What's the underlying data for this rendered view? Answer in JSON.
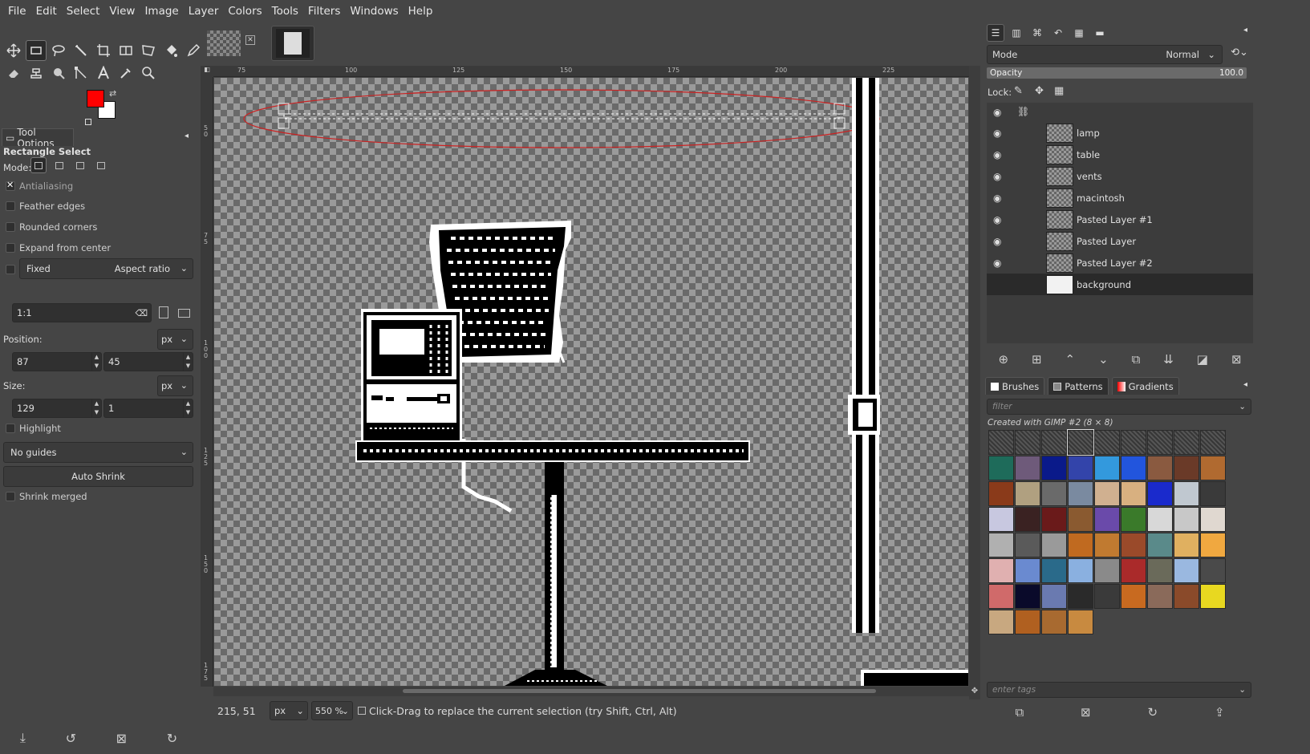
{
  "menu": [
    "File",
    "Edit",
    "Select",
    "View",
    "Image",
    "Layer",
    "Colors",
    "Tools",
    "Filters",
    "Windows",
    "Help"
  ],
  "tool_options": {
    "tab_label": "Tool Options",
    "tool_name": "Rectangle Select",
    "mode_label": "Mode:",
    "antialiasing": "Antialiasing",
    "feather_edges": "Feather edges",
    "rounded_corners": "Rounded corners",
    "expand_from_center": "Expand from center",
    "fixed_label": "Fixed",
    "fixed_value": "Aspect ratio",
    "ratio_value": "1:1",
    "position_label": "Position:",
    "position_unit": "px",
    "position_x": "87",
    "position_y": "45",
    "size_label": "Size:",
    "size_unit": "px",
    "size_w": "129",
    "size_h": "1",
    "highlight": "Highlight",
    "guides": "No guides",
    "auto_shrink": "Auto Shrink",
    "shrink_merged": "Shrink merged"
  },
  "colors": {
    "foreground": "#ff0000",
    "background": "#ffffff",
    "selection_ellipse": "#cc2222"
  },
  "ruler": {
    "h_ticks": [
      "75",
      "100",
      "125",
      "150",
      "175",
      "200",
      "225"
    ],
    "v_ticks": [
      "5\n0",
      "7\n5",
      "1\n0\n0",
      "1\n2\n5",
      "1\n5\n0",
      "1\n7\n5"
    ]
  },
  "status": {
    "coords": "215, 51",
    "unit": "px",
    "zoom": "550 %",
    "message": "Click-Drag to replace the current selection (try Shift, Ctrl, Alt)"
  },
  "layers_panel": {
    "mode_label": "Mode",
    "mode_value": "Normal",
    "opacity_label": "Opacity",
    "opacity_value": "100.0",
    "lock_label": "Lock:",
    "layers": [
      {
        "name": "lamp"
      },
      {
        "name": "table"
      },
      {
        "name": "vents"
      },
      {
        "name": "macintosh"
      },
      {
        "name": "Pasted Layer #1"
      },
      {
        "name": "Pasted Layer"
      },
      {
        "name": "Pasted Layer #2"
      },
      {
        "name": "background"
      }
    ]
  },
  "resources": {
    "tabs": [
      "Brushes",
      "Patterns",
      "Gradients"
    ],
    "filter_placeholder": "filter",
    "pattern_info": "Created with GIMP #2 (8 × 8)",
    "tags_placeholder": "enter tags",
    "pattern_colors": [
      "#e8e8e8",
      "#777777",
      "#cccccc",
      "#999999",
      "#bbbbbb",
      "#dddddd",
      "#888888",
      "#aaaaaa",
      "#666666",
      "#1e6b5a",
      "#6e5a7a",
      "#0a1a8a",
      "#3344aa",
      "#3399dd",
      "#2255dd",
      "#8a5a40",
      "#6a3a28",
      "#b06a30",
      "#8a3a1a",
      "#b0a080",
      "#6a6a6a",
      "#7a8aa0",
      "#d0b090",
      "#d8b080",
      "#1a2acc",
      "#c0c8d0",
      "#3a3a3a",
      "#c8c8e0",
      "#3a2222",
      "#6a1a1a",
      "#8a5a30",
      "#6a4aaa",
      "#3a7a2a",
      "#d8d8d8",
      "#c8c8c8",
      "#e0d8d0",
      "#b0b0b0",
      "#5a5a5a",
      "#9a9a9a",
      "#c06a20",
      "#c07a30",
      "#9a4a2a",
      "#5a8a8a",
      "#e0b060",
      "#f0a840",
      "#e0b0b0",
      "#6a8ad0",
      "#2a6a8a",
      "#8ab0e0",
      "#8a8a8a",
      "#aa2a2a",
      "#6a6a5a",
      "#9ab8e0",
      "#4a4a4a",
      "#d06a6a",
      "#0a0a2a",
      "#6a7ab0",
      "#2a2a2a",
      "#3a3a3a",
      "#c86a20",
      "#8a6a5a",
      "#8a4a2a",
      "#e8d820",
      "#c8a880",
      "#b06020",
      "#a86a30",
      "#c88a40"
    ]
  }
}
